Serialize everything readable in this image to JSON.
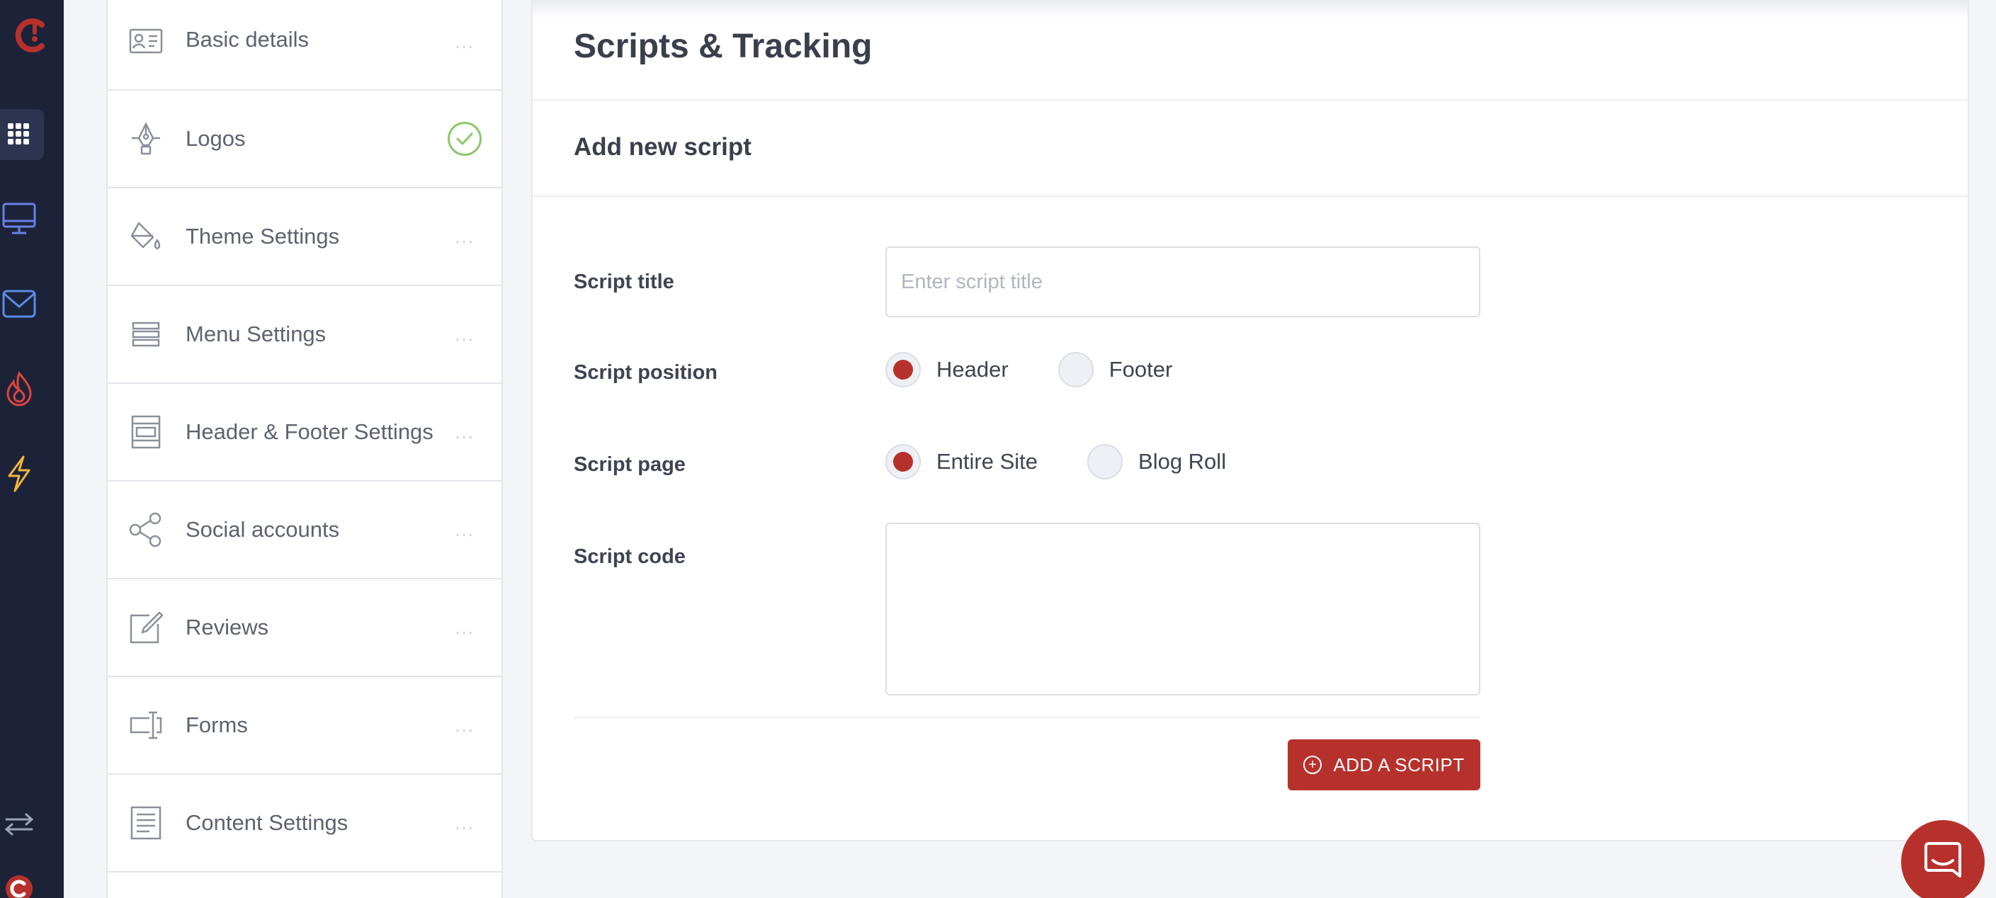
{
  "colors": {
    "accent": "#b7312c",
    "rail_bg": "#1c2338",
    "check_green": "#8cc76a"
  },
  "rail": {
    "items": [
      {
        "icon": "brand-logo-icon"
      },
      {
        "icon": "apps-grid-icon",
        "active": true
      },
      {
        "icon": "monitor-icon"
      },
      {
        "icon": "mail-icon"
      },
      {
        "icon": "fire-icon"
      },
      {
        "icon": "lightning-icon"
      },
      {
        "icon": "swap-arrows-icon"
      },
      {
        "icon": "brand-small-icon"
      }
    ]
  },
  "settings": {
    "items": [
      {
        "label": "Basic details",
        "icon": "id-card-icon",
        "status": "..."
      },
      {
        "label": "Logos",
        "icon": "pen-tool-icon",
        "status": "complete"
      },
      {
        "label": "Theme Settings",
        "icon": "paint-bucket-icon",
        "status": "..."
      },
      {
        "label": "Menu Settings",
        "icon": "menu-lines-icon",
        "status": "..."
      },
      {
        "label": "Header & Footer Settings",
        "icon": "layout-icon",
        "status": "..."
      },
      {
        "label": "Social accounts",
        "icon": "share-icon",
        "status": "..."
      },
      {
        "label": "Reviews",
        "icon": "edit-icon",
        "status": "..."
      },
      {
        "label": "Forms",
        "icon": "text-cursor-icon",
        "status": "..."
      },
      {
        "label": "Content Settings",
        "icon": "document-icon",
        "status": "..."
      }
    ]
  },
  "main": {
    "page_title": "Scripts & Tracking",
    "section_title": "Add new script",
    "form": {
      "title_label": "Script title",
      "title_placeholder": "Enter script title",
      "title_value": "",
      "position_label": "Script position",
      "position_options": [
        "Header",
        "Footer"
      ],
      "position_selected": "Header",
      "page_label": "Script page",
      "page_options": [
        "Entire Site",
        "Blog Roll"
      ],
      "page_selected": "Entire Site",
      "code_label": "Script code",
      "code_value": "",
      "submit_label": "ADD A SCRIPT"
    }
  }
}
